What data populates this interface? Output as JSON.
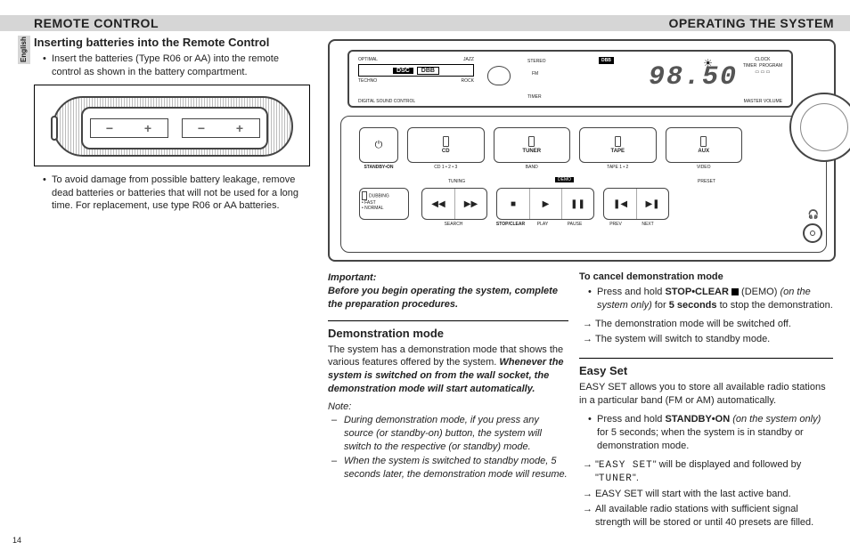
{
  "header": {
    "left": "REMOTE CONTROL",
    "right": "OPERATING THE SYSTEM"
  },
  "lang_tab": "English",
  "page_number": "14",
  "col1": {
    "h": "Inserting batteries into the Remote Control",
    "b1": "Insert the batteries  (Type R06 or AA)  into the remote control as shown in the battery compartment.",
    "b2": "To avoid damage from possible battery leakage, remove dead batteries or batteries that will not be used for a long time. For replacement, use type R06 or AA batteries."
  },
  "important": {
    "lbl": "Important:",
    "txt": "Before you begin operating the system, complete the preparation procedures."
  },
  "demo": {
    "h": "Demonstration mode",
    "p1a": "The system has a demonstration mode that shows the various features offered by the system. ",
    "p1b": "Whenever the system is switched on from the wall socket, the demonstration mode will start automatically.",
    "note_lbl": "Note:",
    "n1": "During demonstration mode, if you press any source (or standby-on) button, the system will switch to the respective (or standby) mode.",
    "n2": "When the system is switched to standby mode, 5 seconds later, the demonstration mode will resume."
  },
  "cancel": {
    "h": "To cancel demonstration mode",
    "b1a": "Press and hold ",
    "b1b": "STOP•CLEAR",
    "b1c": " (DEMO) ",
    "b1d": "(on the system only)",
    "b1e": " for ",
    "b1f": "5 seconds",
    "b1g": " to stop the demonstration.",
    "s1": "The demonstration mode will be switched off.",
    "s2": "The system will switch to standby mode."
  },
  "easy": {
    "h": "Easy Set",
    "p": "EASY SET allows you to store all available radio stations in a particular band (FM or AM) automatically.",
    "b1a": "Press and hold ",
    "b1b": "STANDBY•ON",
    "b1c": " (on the system only)",
    "b1d": " for 5 seconds; when the system is in standby or demonstration mode.",
    "s1a": "\"",
    "s1b": "EASY SET",
    "s1c": "\" will be displayed and followed by \"",
    "s1d": "TUNER",
    "s1e": "\".",
    "s2": "EASY SET will start with the last active band.",
    "s3": "All available radio stations with sufficient signal strength will be stored or until 40 presets are filled."
  },
  "system": {
    "dsc": {
      "tl": "OPTIMAL",
      "tr": "JAZZ",
      "mid_inv": "DSC",
      "mid_box": "DBB",
      "bl": "TECHNO",
      "br": "ROCK",
      "label": "DIGITAL SOUND CONTROL"
    },
    "stereo": "STEREO",
    "fm": "FM",
    "timer": "TIMER",
    "dbb": "DBB",
    "readout": "98.50",
    "clock": "CLOCK",
    "timer2": "TIMER",
    "program": "PROGRAM",
    "master_vol": "MASTER VOLUME",
    "src": {
      "power": "⏻",
      "cd": "CD",
      "tuner": "TUNER",
      "tape": "TAPE",
      "aux": "AUX"
    },
    "src_sub": {
      "standby": "STANDBY•ON",
      "cd": "CD 1 • 2 • 3",
      "band": "BAND",
      "tape": "TAPE 1 • 2",
      "video": "VIDEO"
    },
    "dub": {
      "lbl": "DUBBING",
      "fast": "• FAST",
      "normal": "• NORMAL"
    },
    "tuning": "TUNING",
    "demo": "DEMO",
    "preset": "PRESET",
    "trans_sub": {
      "search": "SEARCH",
      "stopclear": "STOP/CLEAR",
      "play": "PLAY",
      "pause": "PAUSE",
      "prev": "PREV",
      "next": "NEXT"
    },
    "glyphs": {
      "rew": "◀◀",
      "ff": "▶▶",
      "stop": "■",
      "play": "▶",
      "pause": "❚❚",
      "prev": "❚◀",
      "next": "▶❚"
    }
  }
}
